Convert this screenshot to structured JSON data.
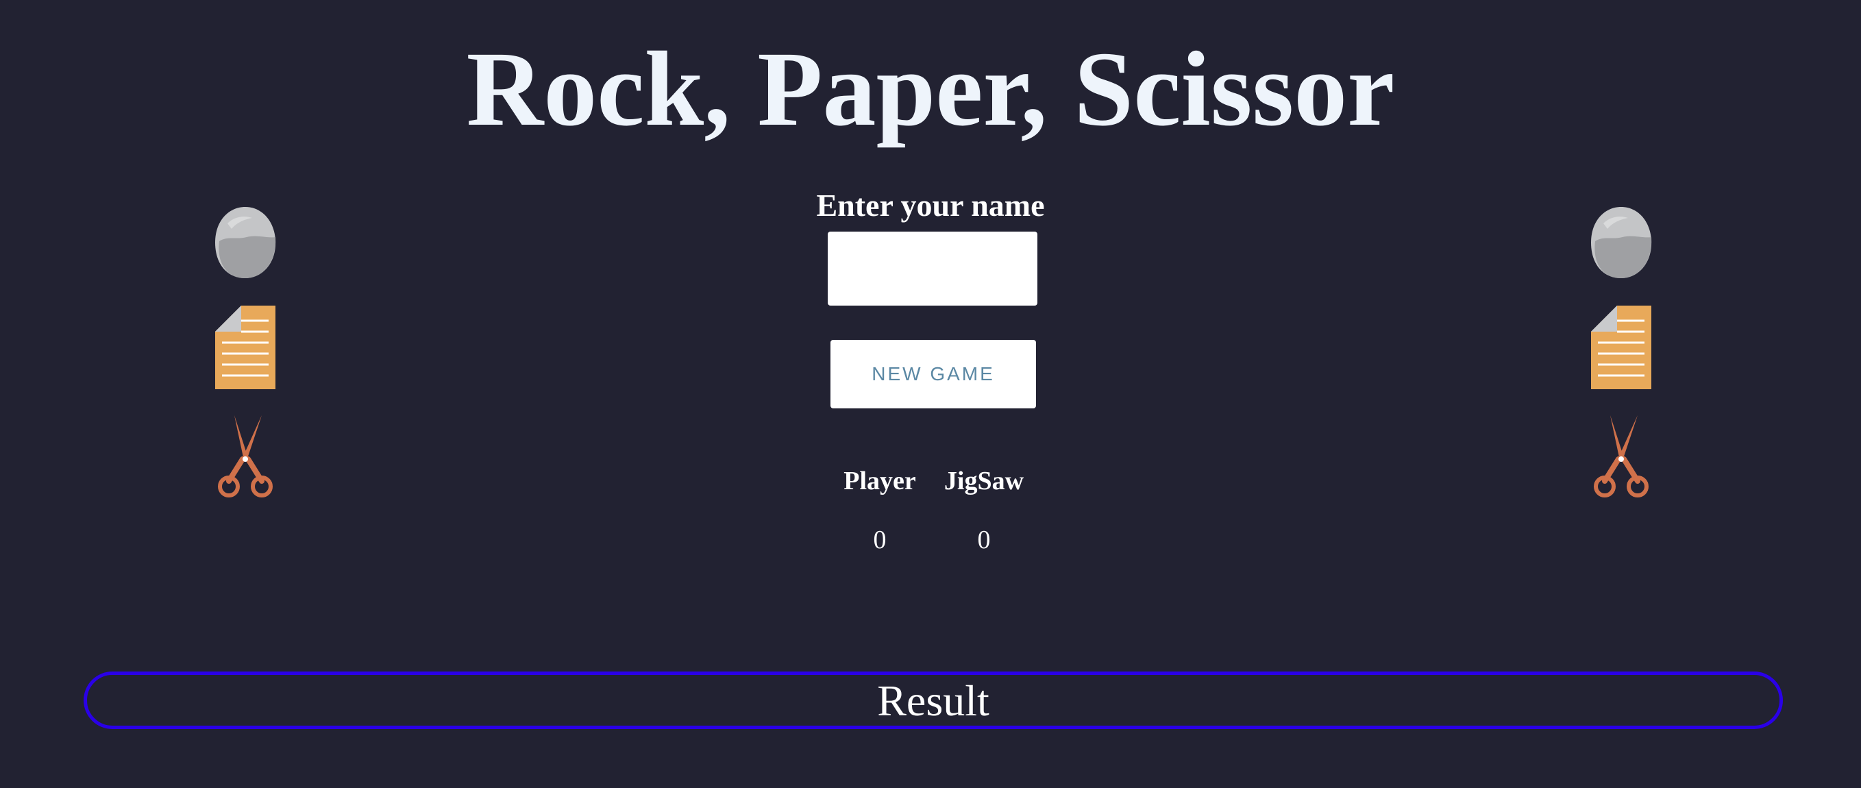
{
  "game": {
    "title": "Rock, Paper, Scissor",
    "name_label": "Enter your name",
    "name_value": "",
    "new_game_label": "NEW GAME",
    "scoreboard": {
      "player_label": "Player",
      "opponent_label": "JigSaw",
      "player_score": "0",
      "opponent_score": "0"
    },
    "result_label": "Result"
  },
  "choices": {
    "left": [
      "rock-icon",
      "paper-icon",
      "scissors-icon"
    ],
    "right": [
      "rock-icon",
      "paper-icon",
      "scissors-icon"
    ]
  },
  "colors": {
    "background": "#222232",
    "result_border": "#2a00e8",
    "button_text": "#5b88a4",
    "paper": "#e8a95a",
    "scissors": "#d0714a",
    "rock": "#b8b9bb"
  }
}
